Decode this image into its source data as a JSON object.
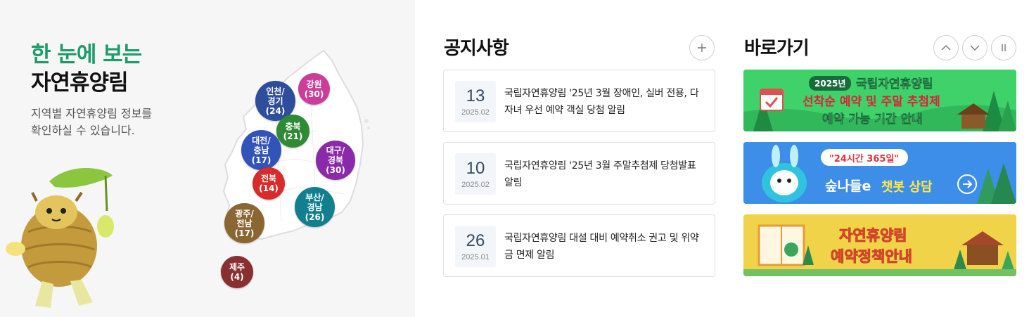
{
  "left": {
    "title_line1": "한 눈에 보는",
    "title_line2": "자연휴양림",
    "desc_line1": "지역별 자연휴양림 정보를",
    "desc_line2": "확인하실 수 있습니다."
  },
  "regions": [
    {
      "line1": "인천/",
      "line2": "경기",
      "count": "(24)",
      "color": "#2e4d9a"
    },
    {
      "line1": "강원",
      "line2": "",
      "count": "(30)",
      "color": "#cc3d9a"
    },
    {
      "line1": "충북",
      "line2": "",
      "count": "(21)",
      "color": "#2f8a35"
    },
    {
      "line1": "대전/",
      "line2": "충남",
      "count": "(17)",
      "color": "#3253b8"
    },
    {
      "line1": "대구/",
      "line2": "경북",
      "count": "(30)",
      "color": "#8a2aa8"
    },
    {
      "line1": "전북",
      "line2": "",
      "count": "(14)",
      "color": "#d82b2b"
    },
    {
      "line1": "부산/",
      "line2": "경남",
      "count": "(26)",
      "color": "#127f8f"
    },
    {
      "line1": "광주/",
      "line2": "전남",
      "count": "(17)",
      "color": "#8a6632"
    },
    {
      "line1": "제주",
      "line2": "",
      "count": "(4)",
      "color": "#8a2f2f"
    }
  ],
  "notice": {
    "title": "공지사항",
    "more_icon": "plus-icon",
    "items": [
      {
        "day": "13",
        "ym": "2025.02",
        "text": "국립자연휴양림 '25년 3월 장애인, 실버 전용, 다자녀 우선 예약 객실 당첨 알림"
      },
      {
        "day": "10",
        "ym": "2025.02",
        "text": "국립자연휴양림 '25년 3월 주말추첨제 당첨발표 알림"
      },
      {
        "day": "26",
        "ym": "2025.01",
        "text": "국립자연휴양림 대설 대비 예약취소 권고 및 위약금 면제 알림"
      }
    ]
  },
  "shortcuts": {
    "title": "바로가기",
    "controls": [
      "chevron-up-icon",
      "chevron-down-icon",
      "pause-icon"
    ],
    "banner1": {
      "badge": "2025년",
      "title": "국립자연휴양림",
      "line2": "선착순 예약 및 주말 추첨제",
      "line3": "예약 가능 기간 안내",
      "bg": "#3fd26a"
    },
    "banner2": {
      "quote": "\"24시간 365일\"",
      "brand": "숲나들e",
      "label": "챗봇 상담",
      "bg": "#3d8ee8"
    },
    "banner3": {
      "line1": "자연휴양림",
      "line2": "예약정책안내",
      "bg": "#f1d34a"
    }
  }
}
